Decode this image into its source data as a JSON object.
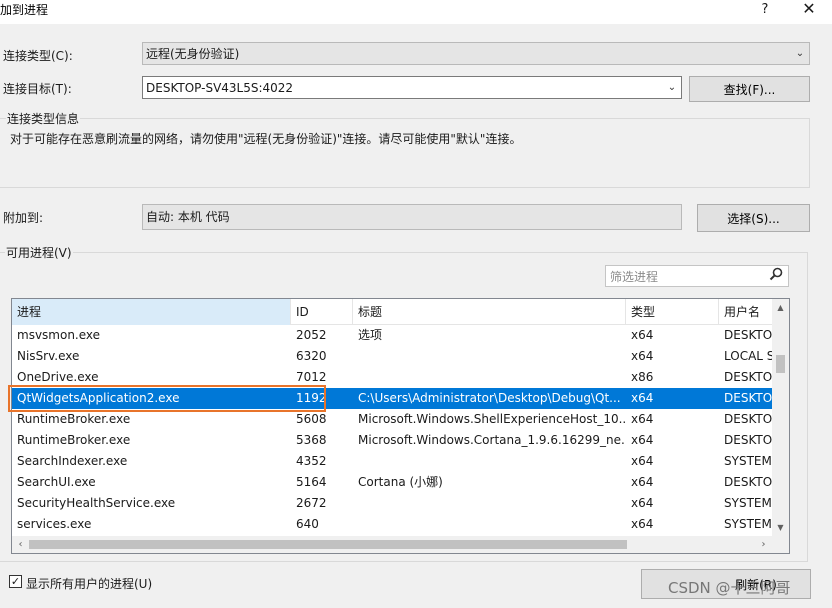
{
  "window": {
    "title": "加到进程",
    "help": "?",
    "close": "✕"
  },
  "form": {
    "conn_type_label": "连接类型(C):",
    "conn_type_value": "远程(无身份验证)",
    "target_label": "连接目标(T):",
    "target_value": "DESKTOP-SV43L5S:4022",
    "find_button": "查找(F)...",
    "info_title": "连接类型信息",
    "info_text": "对于可能存在恶意刷流量的网络，请勿使用\"远程(无身份验证)\"连接。请尽可能使用\"默认\"连接。",
    "attach_label": "附加到:",
    "attach_value": "自动: 本机 代码",
    "select_button": "选择(S)..."
  },
  "processes": {
    "group_title": "可用进程(V)",
    "filter_placeholder": "筛选进程",
    "columns": [
      "进程",
      "ID",
      "标题",
      "类型",
      "用户名"
    ],
    "rows": [
      {
        "name": "msvsmon.exe",
        "id": "2052",
        "title": "选项",
        "type": "x64",
        "user": "DESKTOP"
      },
      {
        "name": "NisSrv.exe",
        "id": "6320",
        "title": "",
        "type": "x64",
        "user": "LOCAL S"
      },
      {
        "name": "OneDrive.exe",
        "id": "7012",
        "title": "",
        "type": "x86",
        "user": "DESKTOP"
      },
      {
        "name": "QtWidgetsApplication2.exe",
        "id": "1192",
        "title": "C:\\Users\\Administrator\\Desktop\\Debug\\Qt...",
        "type": "x64",
        "user": "DESKTOP"
      },
      {
        "name": "RuntimeBroker.exe",
        "id": "5608",
        "title": "Microsoft.Windows.ShellExperienceHost_10...",
        "type": "x64",
        "user": "DESKTOP"
      },
      {
        "name": "RuntimeBroker.exe",
        "id": "5368",
        "title": "Microsoft.Windows.Cortana_1.9.6.16299_ne...",
        "type": "x64",
        "user": "DESKTOP"
      },
      {
        "name": "SearchIndexer.exe",
        "id": "4352",
        "title": "",
        "type": "x64",
        "user": "SYSTEM"
      },
      {
        "name": "SearchUI.exe",
        "id": "5164",
        "title": "Cortana (小娜)",
        "type": "x64",
        "user": "DESKTOP"
      },
      {
        "name": "SecurityHealthService.exe",
        "id": "2672",
        "title": "",
        "type": "x64",
        "user": "SYSTEM"
      },
      {
        "name": "services.exe",
        "id": "640",
        "title": "",
        "type": "x64",
        "user": "SYSTEM"
      }
    ],
    "selected_index": 3,
    "show_all_users_label": "显示所有用户的进程(U)",
    "show_all_users_checked": true,
    "refresh_button": "刷新(R)"
  },
  "watermark": "CSDN @十三阿哥",
  "colors": {
    "selection": "#0078d7",
    "highlight_border": "#e8742b",
    "sorted_header": "#d9ebf9"
  }
}
